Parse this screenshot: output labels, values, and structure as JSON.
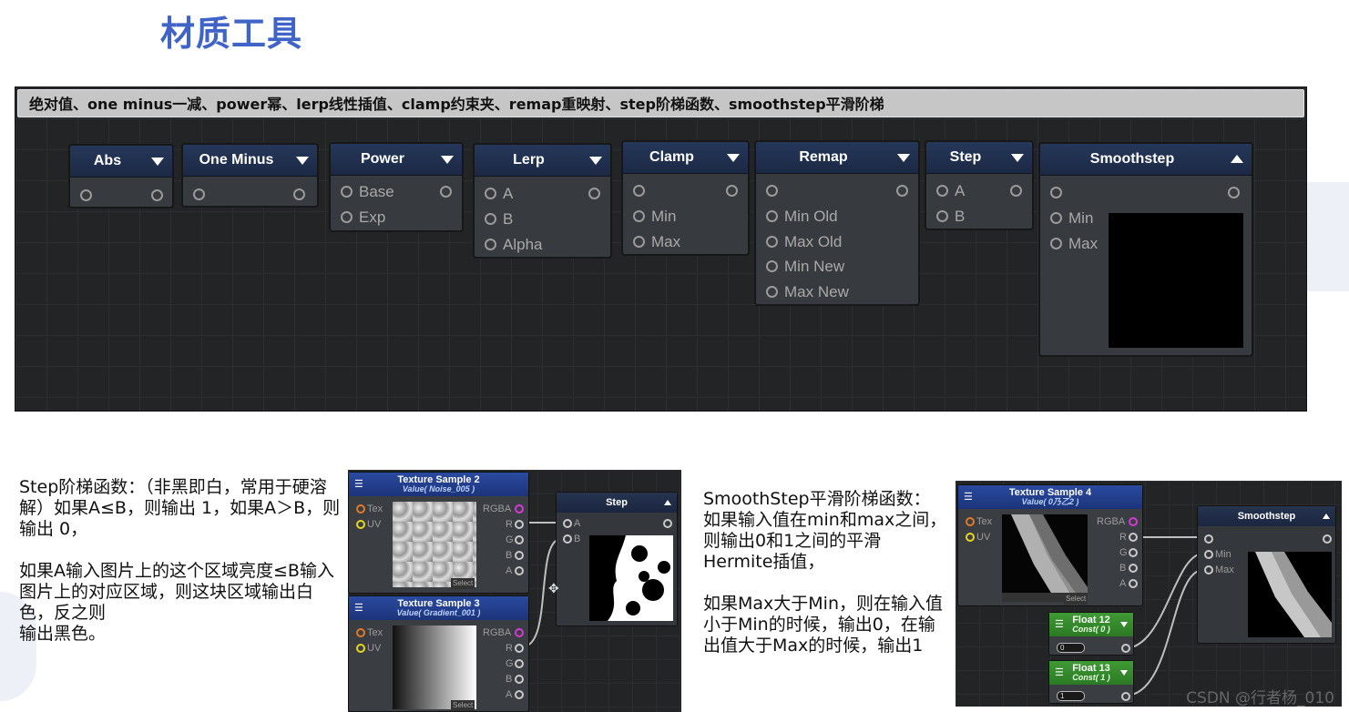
{
  "page": {
    "title": "材质工具",
    "watermark": "CSDN @行者杨_010"
  },
  "panel": {
    "header": "绝对值、one minus一减、power幂、lerp线性插值、clamp约束夹、remap重映射、step阶梯函数、smoothstep平滑阶梯",
    "nodes": [
      {
        "title": "Abs",
        "inputs": []
      },
      {
        "title": "One Minus",
        "inputs": []
      },
      {
        "title": "Power",
        "inputs": [
          "Base",
          "Exp"
        ]
      },
      {
        "title": "Lerp",
        "inputs": [
          "A",
          "B",
          "Alpha"
        ]
      },
      {
        "title": "Clamp",
        "inputs": [
          "",
          "Min",
          "Max"
        ]
      },
      {
        "title": "Remap",
        "inputs": [
          "",
          "Min Old",
          "Max Old",
          "Min New",
          "Max New"
        ]
      },
      {
        "title": "Step",
        "inputs": [
          "A",
          "B"
        ]
      },
      {
        "title": "Smoothstep",
        "inputs": [
          "",
          "Min",
          "Max"
        ]
      }
    ]
  },
  "step_text": {
    "p1": "Step阶梯函数：（非黑即白，常用于硬溶解）如果A≤B，则输出 1，如果A＞B，则输出 0，",
    "p2": "如果A输入图片上的这个区域亮度≤B输入图片上的对应区域，则这块区域输出白色，反之则",
    "p3": "输出黑色。"
  },
  "smooth_text": {
    "p1": "SmoothStep平滑阶梯函数：如果输入值在min和max之间，则输出0和1之间的平滑Hermite插值，",
    "p2": "如果Max大于Min，则在输入值小于Min的时候，输出0，在输出值大于Max的时候，输出1"
  },
  "step_shot": {
    "tex2": {
      "title": "Texture Sample 2",
      "sub": "Value( Noise_005 )"
    },
    "tex3": {
      "title": "Texture Sample 3",
      "sub": "Value( Gradient_001 )"
    },
    "step": {
      "title": "Step"
    },
    "in_tex": "Tex",
    "in_uv": "UV",
    "out": [
      "RGBA",
      "R",
      "G",
      "B",
      "A"
    ],
    "step_in": [
      "A",
      "B"
    ],
    "select": "Select"
  },
  "smooth_shot": {
    "tex4": {
      "title": "Texture Sample 4",
      "sub": "Value( 0乃乙2 )"
    },
    "smooth": {
      "title": "Smoothstep"
    },
    "float12": {
      "title": "Float 12",
      "sub": "Const( 0 )",
      "value": "0"
    },
    "float13": {
      "title": "Float 13",
      "sub": "Const( 1 )",
      "value": "1"
    },
    "in_tex": "Tex",
    "in_uv": "UV",
    "out": [
      "RGBA",
      "R",
      "G",
      "B",
      "A"
    ],
    "smooth_in": [
      "Min",
      "Max"
    ],
    "select": "Select"
  },
  "colors": {
    "title": "#3f63c6",
    "port_tex": "#e07a2a",
    "port_uv": "#e8d620",
    "port_rgba": "#d63ad6"
  }
}
